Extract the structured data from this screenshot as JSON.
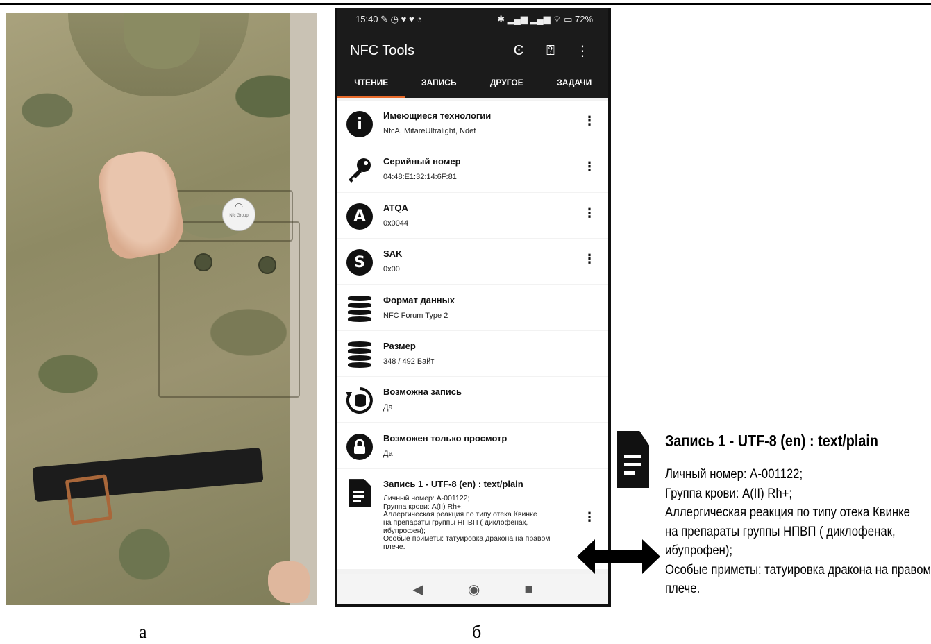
{
  "figure": {
    "label_a": "а",
    "label_b": "б"
  },
  "photo": {
    "tag_text": "Nfc Group"
  },
  "status": {
    "time": "15:40",
    "battery": "72"
  },
  "app": {
    "title": "NFC Tools"
  },
  "tabs": [
    "ЧТЕНИЕ",
    "ЗАПИСЬ",
    "ДРУГОЕ",
    "ЗАДАЧИ"
  ],
  "rows": [
    {
      "icon": "info-icon",
      "glyph": "i",
      "title": "Имеющиеся технологии",
      "value": "NfcA, MifareUltralight, Ndef",
      "menu": true
    },
    {
      "icon": "key-icon",
      "title": "Серийный номер",
      "value": "04:48:E1:32:14:6F:81",
      "menu": true
    },
    {
      "icon": "letter-a-icon",
      "glyph": "A",
      "title": "ATQA",
      "value": "0x0044",
      "menu": true
    },
    {
      "icon": "letter-s-icon",
      "glyph": "S",
      "title": "SAK",
      "value": "0x00",
      "menu": true
    },
    {
      "icon": "database-icon",
      "title": "Формат данных",
      "value": "NFC Forum Type 2",
      "menu": false
    },
    {
      "icon": "database-icon",
      "title": "Размер",
      "value": "348 / 492 Байт",
      "menu": false
    },
    {
      "icon": "rewrite-icon",
      "title": "Возможна запись",
      "value": "Да",
      "menu": false
    },
    {
      "icon": "lock-icon",
      "title": "Возможен только просмотр",
      "value": "Да",
      "menu": false
    }
  ],
  "record": {
    "title": "Запись 1 - UTF-8 (en) : text/plain",
    "text": "Личный номер: А-001122;\nГруппа крови: А(II) Rh+;\nАллергическая реакция по типу отека Квинке\nна препараты группы НПВП ( диклофенак,\nибупрофен);\nОсобые приметы: татуировка дракона на правом\nплече."
  },
  "colors": {
    "accent": "#e86a2a",
    "appbar": "#1b1b1b"
  }
}
